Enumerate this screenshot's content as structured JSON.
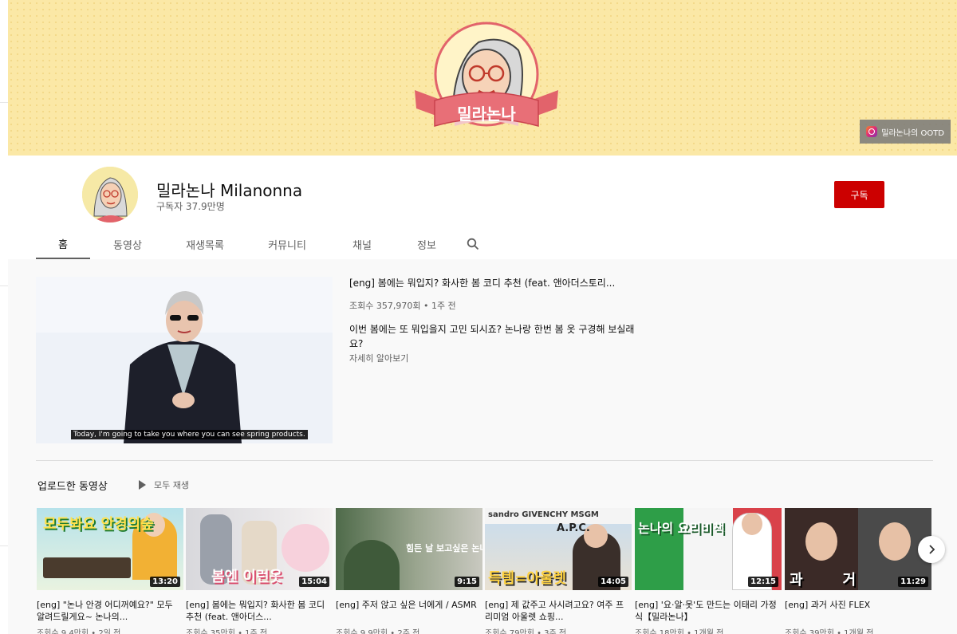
{
  "banner": {
    "logo_text": "밀라논나",
    "instagram_label": "밀라논나의 OOTD"
  },
  "channel": {
    "name": "밀라논나 Milanonna",
    "subscribers": "구독자 37.9만명",
    "subscribe_label": "구독"
  },
  "tabs": [
    "홈",
    "동영상",
    "재생목록",
    "커뮤니티",
    "채널",
    "정보"
  ],
  "featured": {
    "title": "[eng] 봄에는 뭐입지? 화사한 봄 코디 추천 (feat. 앤아더스토리...",
    "meta": "조회수 357,970회 • 1주 전",
    "description": "이번 봄에는 또 뭐입을지 고민 되시죠? 논나랑 한번 봄 옷 구경해 보실래요?",
    "more": "자세히 알아보기",
    "caption": "Today, I'm going to take you where you can see spring products."
  },
  "shelf": {
    "title": "업로드한 동영상",
    "play_all": "모두 재생"
  },
  "videos": [
    {
      "title": "[eng] \"논나 안경 어디꺼예요?\" 모두 알려드릴게요~ 논나의...",
      "meta": "조회수 9.4만회 • 2일 전",
      "duration": "13:20",
      "overlay": "모두봐요 안경의숲"
    },
    {
      "title": "[eng] 봄에는 뭐입지? 화사한 봄 코디 추천 (feat. 앤아더스...",
      "meta": "조회수 35만회 • 1주 전",
      "duration": "15:04",
      "overlay": "봄엔 이런옷"
    },
    {
      "title": "[eng] 주저 앉고 싶은 너에게 / ASMR",
      "meta": "조회수 9.9만회 • 2주 전",
      "duration": "9:15",
      "overlay": "힘든 날 보고싶은 논나 ASMR"
    },
    {
      "title": "[eng] 제 값주고 사시려고요? 여주 프리미엄 아울렛 쇼핑...",
      "meta": "조회수 79만회 • 3주 전",
      "duration": "14:05",
      "overlay": "득템=아울렛"
    },
    {
      "title": "[eng] '요·알·못'도 만드는 이태리 가정식【밀라논나】",
      "meta": "조회수 18만회 • 1개월 전",
      "duration": "12:15",
      "overlay": "논나의 요리비책"
    },
    {
      "title": "[eng] 과거 사진 FLEX",
      "meta": "조회수 39만회 • 1개월 전",
      "duration": "11:29",
      "overlay": "과거 사진"
    }
  ],
  "colors": {
    "banner_bg": "#fbe8a6",
    "subscribe_red": "#cc0000",
    "ribbon_red": "#e2636b"
  }
}
